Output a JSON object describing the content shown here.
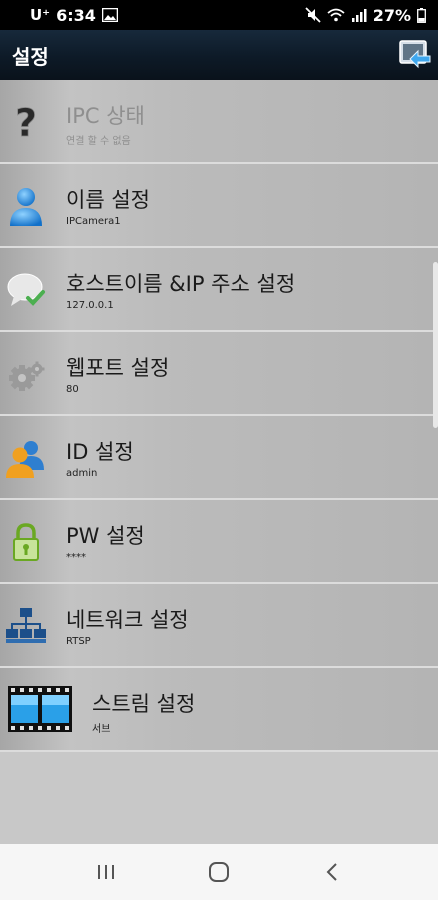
{
  "status_bar": {
    "carrier": "U⁺",
    "time": "6:34",
    "battery": "27%"
  },
  "app_bar": {
    "title": "설정"
  },
  "settings": [
    {
      "title": "IPC 상태",
      "subtitle": "연결 할 수 없음",
      "icon": "question-icon",
      "enabled": false
    },
    {
      "title": "이름 설정",
      "subtitle": "IPCamera1",
      "icon": "person-icon",
      "enabled": true
    },
    {
      "title": "호스트이름 &IP 주소 설정",
      "subtitle": "127.0.0.1",
      "icon": "chat-bubble-check-icon",
      "enabled": true
    },
    {
      "title": "웹포트 설정",
      "subtitle": "80",
      "icon": "gears-icon",
      "enabled": true
    },
    {
      "title": "ID 설정",
      "subtitle": "admin",
      "icon": "users-icon",
      "enabled": true
    },
    {
      "title": "PW 설정",
      "subtitle": "****",
      "icon": "lock-icon",
      "enabled": true
    },
    {
      "title": "네트워크 설정",
      "subtitle": "RTSP",
      "icon": "network-icon",
      "enabled": true
    },
    {
      "title": "스트림 설정",
      "subtitle": "서브",
      "icon": "film-icon",
      "enabled": true
    }
  ],
  "colors": {
    "app_bar": "#0d1a27",
    "list_bg": "#bbbbbb",
    "divider": "#dcdcdc"
  }
}
